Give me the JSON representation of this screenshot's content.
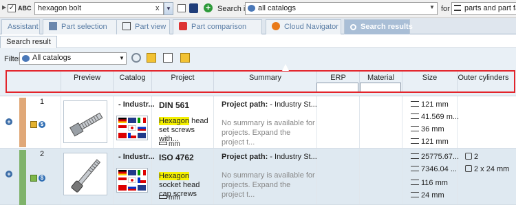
{
  "search": {
    "abc_label": "ABC",
    "query": "hexagon bolt",
    "search_in_label": "Search in",
    "catalog_value": "all catalogs",
    "for_label": "for",
    "for_value": "parts and part families"
  },
  "tabs": [
    {
      "label": "Assistant"
    },
    {
      "label": "Part selection"
    },
    {
      "label": "Part view"
    },
    {
      "label": "Part comparison"
    },
    {
      "label": "Cloud Navigator"
    },
    {
      "label": "Search results",
      "active": true
    }
  ],
  "subtab": {
    "label": "Search result"
  },
  "filter": {
    "label": "Filter:",
    "value": "All catalogs"
  },
  "columns": [
    "Preview",
    "Catalog",
    "Project",
    "Summary",
    "ERP number",
    "Material",
    "Size",
    "Outer cylinders"
  ],
  "rows": [
    {
      "num": "1",
      "catalog": "- Industr...",
      "project_title": "DIN 561",
      "project_desc_highlight": "Hexagon",
      "project_desc_rest": " head set screws with...",
      "ruler_unit": "mm",
      "summary_title": "Project path:",
      "summary_path": " - Industry St...",
      "summary_text": "No summary is available for projects. Expand the project t...",
      "size": [
        "121 mm",
        "41.569 m...",
        "36 mm",
        "121 mm"
      ],
      "outer": []
    },
    {
      "num": "2",
      "catalog": "- Industr...",
      "project_title": "ISO 4762",
      "project_desc_highlight": "Hexagon",
      "project_desc_rest": " socket head cap screws",
      "ruler_unit": "mm",
      "summary_title": "Project path:",
      "summary_path": " - Industry St...",
      "summary_text": "No summary is available for projects. Expand the project t...",
      "size": [
        "25775.67...",
        "7346.04 ...",
        "116 mm",
        "24 mm"
      ],
      "outer": [
        "2",
        "2 x 24 mm"
      ]
    }
  ],
  "colors": {
    "row1_bar": "#e0a878",
    "row2_bar": "#7fb36b",
    "highlight": "#f4f000",
    "redbox": "#e3242b"
  }
}
